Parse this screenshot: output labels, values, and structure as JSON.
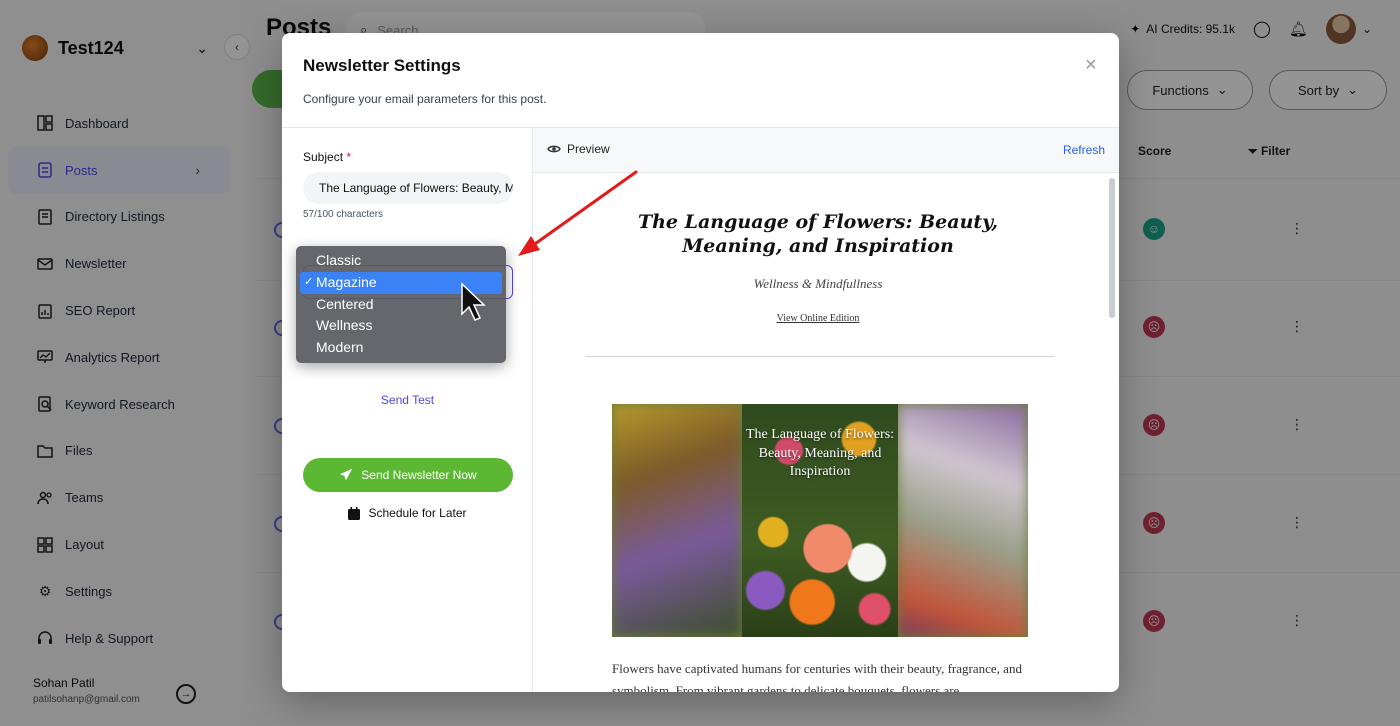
{
  "app": {
    "workspace_name": "Test124",
    "page_title": "Posts",
    "search_placeholder": "Search",
    "ai_credits": "AI Credits: 95.1k",
    "functions_label": "Functions",
    "sortby_label": "Sort by",
    "table_headers": {
      "score": "Score",
      "filter": "Filter"
    }
  },
  "sidebar": {
    "items": [
      {
        "label": "Dashboard",
        "icon": "dashboard-icon"
      },
      {
        "label": "Posts",
        "icon": "posts-icon"
      },
      {
        "label": "Directory Listings",
        "icon": "directory-icon"
      },
      {
        "label": "Newsletter",
        "icon": "mail-icon"
      },
      {
        "label": "SEO Report",
        "icon": "seo-icon"
      },
      {
        "label": "Analytics Report",
        "icon": "analytics-icon"
      },
      {
        "label": "Keyword Research",
        "icon": "keyword-icon"
      },
      {
        "label": "Files",
        "icon": "folder-icon"
      },
      {
        "label": "Teams",
        "icon": "teams-icon"
      },
      {
        "label": "Layout",
        "icon": "layout-icon"
      },
      {
        "label": "Settings",
        "icon": "gear-icon"
      },
      {
        "label": "Help & Support",
        "icon": "headset-icon"
      }
    ],
    "user_name": "Sohan Patil",
    "user_email": "patilsohanp@gmail.com"
  },
  "modal": {
    "title": "Newsletter Settings",
    "subtitle": "Configure your email parameters for this post.",
    "subject_label": "Subject",
    "required_mark": "*",
    "subject_value": "The Language of Flowers: Beauty, Meaning, and Inspiration",
    "char_count": "57/100 characters",
    "send_test": "Send Test",
    "send_now": "Send Newsletter Now",
    "schedule": "Schedule for Later",
    "preview_label": "Preview",
    "refresh_label": "Refresh"
  },
  "dropdown": {
    "options": [
      "Classic",
      "Magazine",
      "Centered",
      "Wellness",
      "Modern"
    ],
    "selected": "Magazine",
    "check": "✓"
  },
  "preview": {
    "title": "The Language of Flowers: Beauty, Meaning, and Inspiration",
    "category": "Wellness & Mindfullness",
    "online_link": "View Online Edition",
    "image_text": "The Language of Flowers: Beauty, Meaning, and Inspiration",
    "paragraph": "Flowers have captivated humans for centuries with their beauty, fragrance, and symbolism. From vibrant gardens to delicate bouquets, flowers are"
  },
  "colors": {
    "accent": "#4f46e5",
    "send_button": "#5cb832",
    "link": "#2563eb",
    "selected_option": "#3b82f6",
    "arrow": "#e31b1b",
    "score_good": "#1aa58b",
    "score_bad": "#c23a55"
  }
}
